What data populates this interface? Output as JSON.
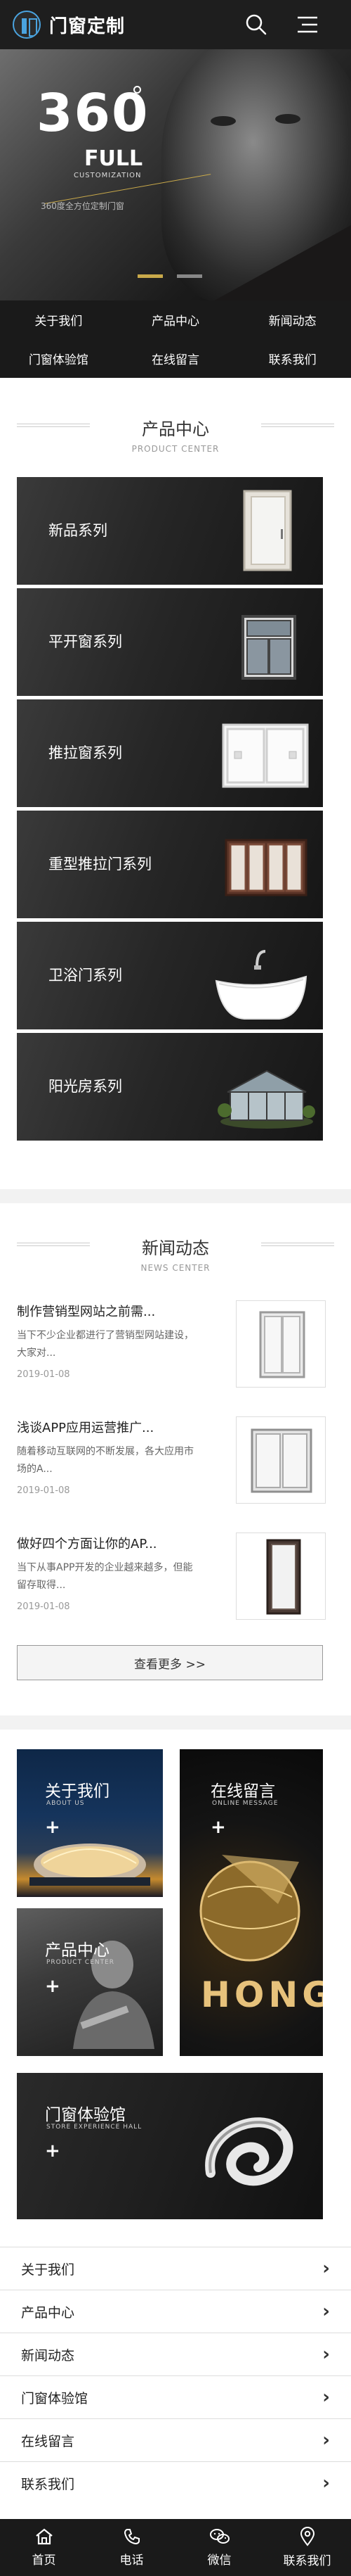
{
  "header": {
    "brand": "门窗定制",
    "icons": [
      "search-icon",
      "menu-icon"
    ]
  },
  "banner": {
    "big_number": "360",
    "word": "FULL",
    "sub_en": "CUSTOMIZATION",
    "sub_cn": "360度全方位定制门窗"
  },
  "quick_nav": [
    "关于我们",
    "产品中心",
    "新闻动态",
    "门窗体验馆",
    "在线留言",
    "联系我们"
  ],
  "product_center": {
    "title": "产品中心",
    "subtitle": "PRODUCT CENTER",
    "items": [
      "新品系列",
      "平开窗系列",
      "推拉窗系列",
      "重型推拉门系列",
      "卫浴门系列",
      "阳光房系列"
    ]
  },
  "news": {
    "title": "新闻动态",
    "subtitle": "NEWS CENTER",
    "items": [
      {
        "title": "制作营销型网站之前需...",
        "desc": "当下不少企业都进行了营销型网站建设，大家对...",
        "date": "2019-01-08"
      },
      {
        "title": "浅谈APP应用运营推广...",
        "desc": "随着移动互联网的不断发展，各大应用市场的A...",
        "date": "2019-01-08"
      },
      {
        "title": "做好四个方面让你的AP...",
        "desc": "当下从事APP开发的企业越来越多，但能留存取得...",
        "date": "2019-01-08"
      }
    ],
    "more_label": "查看更多 >>"
  },
  "tiles": {
    "about": {
      "title": "关于我们",
      "en": "ABOUT US"
    },
    "message": {
      "title": "在线留言",
      "en": "ONLINE MESSAGE",
      "deco": "HONGYU"
    },
    "product": {
      "title": "产品中心",
      "en": "PRODUCT CENTER"
    },
    "hall": {
      "title": "门窗体验馆",
      "en": "STORE EXPERIENCE HALL"
    }
  },
  "bottom_links": [
    "关于我们",
    "产品中心",
    "新闻动态",
    "门窗体验馆",
    "在线留言",
    "联系我们"
  ],
  "tabbar": [
    {
      "label": "首页",
      "icon": "home-icon"
    },
    {
      "label": "电话",
      "icon": "phone-icon"
    },
    {
      "label": "微信",
      "icon": "wechat-icon"
    },
    {
      "label": "联系我们",
      "icon": "location-icon"
    }
  ]
}
